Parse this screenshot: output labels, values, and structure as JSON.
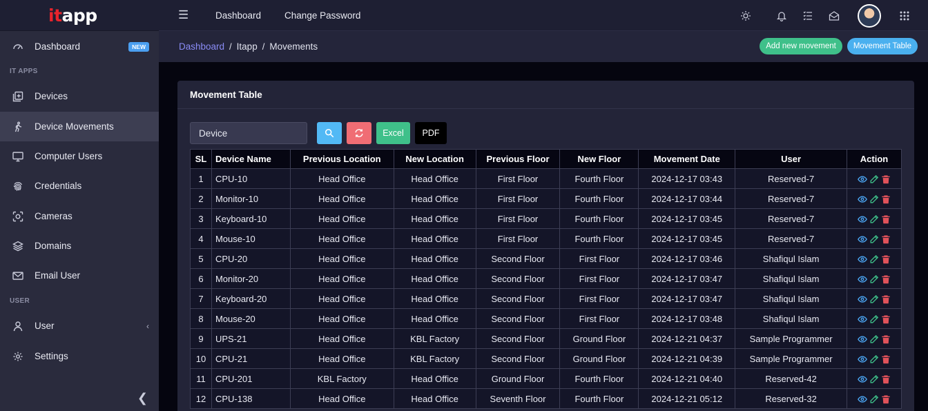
{
  "brand": {
    "part1": "it",
    "part2": "app"
  },
  "sidebar": {
    "dashboard": {
      "label": "Dashboard",
      "badge": "NEW"
    },
    "section_it_apps": "IT APPS",
    "items": [
      {
        "label": "Devices",
        "icon": "devices-icon"
      },
      {
        "label": "Device Movements",
        "icon": "walking-icon",
        "active": true
      },
      {
        "label": "Computer Users",
        "icon": "monitor-icon"
      },
      {
        "label": "Credentials",
        "icon": "fingerprint-icon"
      },
      {
        "label": "Cameras",
        "icon": "camera-icon"
      },
      {
        "label": "Domains",
        "icon": "layers-icon"
      },
      {
        "label": "Email User",
        "icon": "envelope-icon"
      }
    ],
    "section_user": "USER",
    "user_label": "User",
    "settings_label": "Settings"
  },
  "topbar": {
    "dashboard_link": "Dashboard",
    "change_password_link": "Change Password"
  },
  "breadcrumb": {
    "home": "Dashboard",
    "app": "Itapp",
    "current": "Movements"
  },
  "actions": {
    "add_new": "Add new movement",
    "table": "Movement Table"
  },
  "card": {
    "title": "Movement Table"
  },
  "toolbar": {
    "search_value": "Device",
    "excel": "Excel",
    "pdf": "PDF"
  },
  "colors": {
    "accent_green": "#3fc08a",
    "accent_blue": "#4ab0ef",
    "danger": "#f06d74",
    "link": "#8a8cf6"
  },
  "table": {
    "headers": {
      "sl": "SL",
      "device": "Device Name",
      "prev_loc": "Previous Location",
      "new_loc": "New Location",
      "prev_floor": "Previous Floor",
      "new_floor": "New Floor",
      "date": "Movement Date",
      "user": "User",
      "action": "Action"
    },
    "rows": [
      {
        "sl": "1",
        "device": "CPU-10",
        "prev_loc": "Head Office",
        "new_loc": "Head Office",
        "prev_floor": "First Floor",
        "new_floor": "Fourth Floor",
        "date": "2024-12-17 03:43",
        "user": "Reserved-7"
      },
      {
        "sl": "2",
        "device": "Monitor-10",
        "prev_loc": "Head Office",
        "new_loc": "Head Office",
        "prev_floor": "First Floor",
        "new_floor": "Fourth Floor",
        "date": "2024-12-17 03:44",
        "user": "Reserved-7"
      },
      {
        "sl": "3",
        "device": "Keyboard-10",
        "prev_loc": "Head Office",
        "new_loc": "Head Office",
        "prev_floor": "First Floor",
        "new_floor": "Fourth Floor",
        "date": "2024-12-17 03:45",
        "user": "Reserved-7"
      },
      {
        "sl": "4",
        "device": "Mouse-10",
        "prev_loc": "Head Office",
        "new_loc": "Head Office",
        "prev_floor": "First Floor",
        "new_floor": "Fourth Floor",
        "date": "2024-12-17 03:45",
        "user": "Reserved-7"
      },
      {
        "sl": "5",
        "device": "CPU-20",
        "prev_loc": "Head Office",
        "new_loc": "Head Office",
        "prev_floor": "Second Floor",
        "new_floor": "First Floor",
        "date": "2024-12-17 03:46",
        "user": "Shafiqul Islam"
      },
      {
        "sl": "6",
        "device": "Monitor-20",
        "prev_loc": "Head Office",
        "new_loc": "Head Office",
        "prev_floor": "Second Floor",
        "new_floor": "First Floor",
        "date": "2024-12-17 03:47",
        "user": "Shafiqul Islam"
      },
      {
        "sl": "7",
        "device": "Keyboard-20",
        "prev_loc": "Head Office",
        "new_loc": "Head Office",
        "prev_floor": "Second Floor",
        "new_floor": "First Floor",
        "date": "2024-12-17 03:47",
        "user": "Shafiqul Islam"
      },
      {
        "sl": "8",
        "device": "Mouse-20",
        "prev_loc": "Head Office",
        "new_loc": "Head Office",
        "prev_floor": "Second Floor",
        "new_floor": "First Floor",
        "date": "2024-12-17 03:48",
        "user": "Shafiqul Islam"
      },
      {
        "sl": "9",
        "device": "UPS-21",
        "prev_loc": "Head Office",
        "new_loc": "KBL Factory",
        "prev_floor": "Second Floor",
        "new_floor": "Ground Floor",
        "date": "2024-12-21 04:37",
        "user": "Sample Programmer"
      },
      {
        "sl": "10",
        "device": "CPU-21",
        "prev_loc": "Head Office",
        "new_loc": "KBL Factory",
        "prev_floor": "Second Floor",
        "new_floor": "Ground Floor",
        "date": "2024-12-21 04:39",
        "user": "Sample Programmer"
      },
      {
        "sl": "11",
        "device": "CPU-201",
        "prev_loc": "KBL Factory",
        "new_loc": "Head Office",
        "prev_floor": "Ground Floor",
        "new_floor": "Fourth Floor",
        "date": "2024-12-21 04:40",
        "user": "Reserved-42"
      },
      {
        "sl": "12",
        "device": "CPU-138",
        "prev_loc": "Head Office",
        "new_loc": "Head Office",
        "prev_floor": "Seventh Floor",
        "new_floor": "Fourth Floor",
        "date": "2024-12-21 05:12",
        "user": "Reserved-32"
      }
    ]
  }
}
